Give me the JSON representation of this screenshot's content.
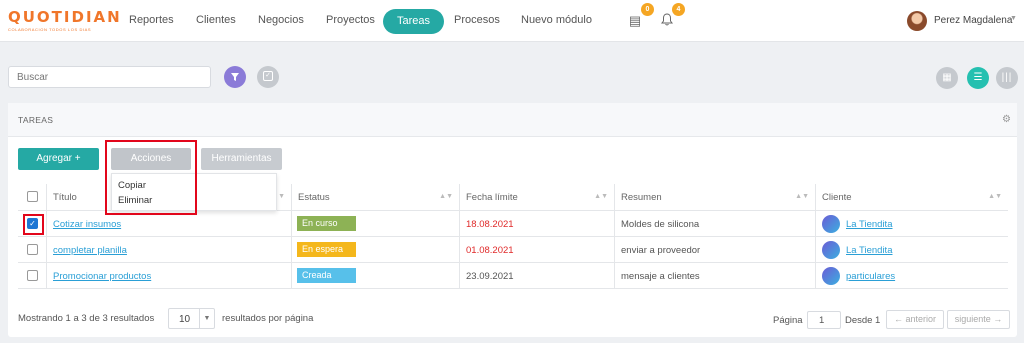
{
  "header": {
    "logo": "QUOTIDIAN",
    "logo_tagline": "COLABORACION TODOS LOS DIAS",
    "nav": [
      "Reportes",
      "Clientes",
      "Negocios",
      "Proyectos",
      "Tareas",
      "Procesos",
      "Nuevo módulo"
    ],
    "active_nav": "Tareas",
    "messages_badge": "0",
    "notifications_badge": "4",
    "user_name": "Perez Magdalena"
  },
  "search": {
    "placeholder": "Buscar"
  },
  "panel": {
    "title": "TAREAS",
    "add_button": "Agregar +",
    "actions_button": "Acciones",
    "tools_button": "Herramientas",
    "actions_menu": [
      "Copiar",
      "Eliminar"
    ]
  },
  "table": {
    "columns": [
      "Título",
      "Estatus",
      "Fecha límite",
      "Resumen",
      "Cliente"
    ],
    "rows": [
      {
        "checked": true,
        "title": "Cotizar insumos",
        "status": "En curso",
        "status_color": "#8db255",
        "due": "18.08.2021",
        "due_overdue": true,
        "summary": "Moldes de silicona",
        "client": "La Tiendita"
      },
      {
        "checked": false,
        "title": "completar planilla",
        "status": "En espera",
        "status_color": "#f4b71c",
        "due": "01.08.2021",
        "due_overdue": true,
        "summary": "enviar a proveedor",
        "client": "La Tiendita"
      },
      {
        "checked": false,
        "title": "Promocionar productos",
        "status": "Creada",
        "status_color": "#57c0ea",
        "due": "23.09.2021",
        "due_overdue": false,
        "summary": "mensaje a clientes",
        "client": "particulares"
      }
    ]
  },
  "footer": {
    "showing": "Mostrando 1 a 3 de 3 resultados",
    "page_size": "10",
    "per_page_label": "resultados por página",
    "page_label": "Página",
    "page_value": "1",
    "of_label": "Desde",
    "total_pages": "1",
    "prev": "← anterior",
    "next": "siguiente →"
  },
  "colors": {
    "accent": "#25a9a4",
    "brand": "#f0762a",
    "highlight": "#e2061b"
  }
}
